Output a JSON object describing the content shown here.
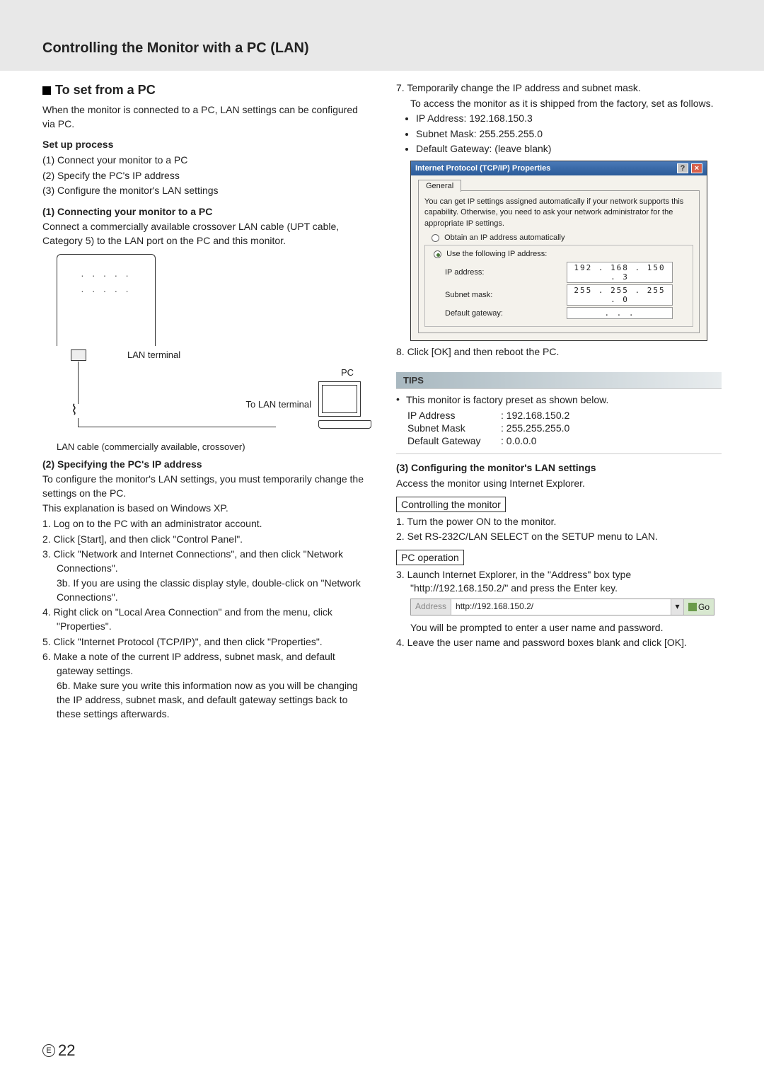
{
  "header": {
    "title": "Controlling the Monitor with a PC (LAN)"
  },
  "left": {
    "section_title": "To set from a PC",
    "intro": "When the monitor is connected to a PC, LAN settings can be configured via PC.",
    "setup_heading": "Set up process",
    "setup_items": [
      "(1) Connect your monitor to a PC",
      "(2) Specify the PC's IP address",
      "(3) Configure the monitor's LAN settings"
    ],
    "sub1_heading": "(1) Connecting your monitor to a PC",
    "sub1_text": "Connect a commercially available crossover LAN cable (UPT cable, Category 5) to the LAN  port on the PC and this monitor.",
    "diagram": {
      "lan_terminal": "LAN terminal",
      "pc": "PC",
      "to_lan_terminal": "To LAN terminal",
      "cable_caption": "LAN cable (commercially available, crossover)"
    },
    "sub2_heading": "(2) Specifying the PC's IP address",
    "sub2_intro1": "To configure the monitor's LAN settings, you must temporarily change the settings on the PC.",
    "sub2_intro2": "This explanation is based on Windows XP.",
    "sub2_steps": [
      "1.  Log on to the PC with an administrator account.",
      "2.  Click [Start], and then click \"Control Panel\".",
      "3.  Click \"Network and Internet Connections\", and then click \"Network Connections\".",
      "3b. If you are using the classic display style, double-click on \"Network Connections\".",
      "4.  Right click on \"Local Area Connection\" and from the menu, click \"Properties\".",
      "5.  Click \"Internet Protocol (TCP/IP)\", and then click \"Properties\".",
      "6.  Make a note of the current IP address, subnet mask, and default gateway settings.",
      "6b. Make sure you write this information now as you will be changing the IP address, subnet mask, and default gateway settings back to these settings afterwards."
    ]
  },
  "right": {
    "step7_a": "7.  Temporarily change the IP address and subnet mask.",
    "step7_b": "To access the monitor as it is shipped from the factory, set as follows.",
    "step7_bullets": [
      "IP Address: 192.168.150.3",
      "Subnet Mask: 255.255.255.0",
      "Default Gateway: (leave blank)"
    ],
    "dialog": {
      "title": "Internet Protocol (TCP/IP) Properties",
      "tab": "General",
      "desc": "You can get IP settings assigned automatically if your network supports this capability. Otherwise, you need to ask your network administrator for the appropriate IP settings.",
      "radio_auto": "Obtain an IP address automatically",
      "radio_manual": "Use the following IP address:",
      "ip_label": "IP address:",
      "ip_value": "192 . 168 . 150 .   3",
      "subnet_label": "Subnet mask:",
      "subnet_value": "255 . 255 . 255 .   0",
      "gateway_label": "Default gateway:",
      "gateway_value": ".       .       ."
    },
    "step8": "8.  Click [OK] and then reboot the PC.",
    "tips_label": "TIPS",
    "tips_intro": "This monitor is factory preset as shown below.",
    "tips_table": {
      "ip_label": "IP Address",
      "ip_value": ": 192.168.150.2",
      "subnet_label": "Subnet Mask",
      "subnet_value": ": 255.255.255.0",
      "gateway_label": "Default Gateway",
      "gateway_value": ": 0.0.0.0"
    },
    "sub3_heading": "(3) Configuring the monitor's LAN settings",
    "sub3_intro": "Access the monitor using Internet Explorer.",
    "box_controlling": "Controlling the monitor",
    "ctrl_steps": [
      "1.  Turn the power ON to the monitor.",
      "2.  Set RS-232C/LAN SELECT on the SETUP menu to LAN."
    ],
    "box_pc_op": "PC operation",
    "pc_op_step3a": "3.  Launch Internet Explorer, in the \"Address\" box type \"http://192.168.150.2/\" and press the Enter key.",
    "address_bar": {
      "label": "Address",
      "value": "http://192.168.150.2/",
      "go": "Go"
    },
    "pc_op_after": "You will be prompted to enter a user name and password.",
    "pc_op_step4": "4.  Leave the user name and password boxes blank and click [OK]."
  },
  "page_number": "22",
  "page_e": "E"
}
